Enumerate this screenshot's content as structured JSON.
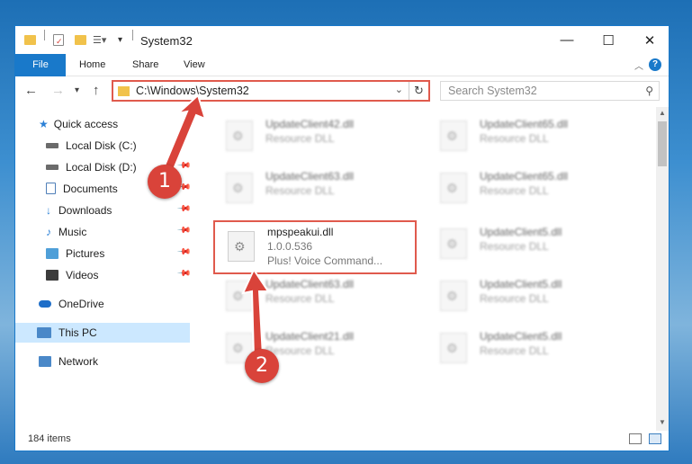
{
  "window": {
    "title": "System32"
  },
  "titlebar": {
    "minimize": "—",
    "maximize": "☐",
    "close": "✕"
  },
  "ribbon": {
    "tabs": [
      "File",
      "Home",
      "Share",
      "View"
    ],
    "help": "?"
  },
  "nav": {
    "address": "C:\\Windows\\System32",
    "search_placeholder": "Search System32"
  },
  "sidebar": {
    "items": [
      {
        "label": "Quick access",
        "icon": "star-icon",
        "color": "#2b80d6"
      },
      {
        "label": "Local Disk (C:)",
        "icon": "drive-icon",
        "color": "#6b6b6b"
      },
      {
        "label": "Local Disk (D:)",
        "icon": "drive-icon",
        "color": "#6b6b6b"
      },
      {
        "label": "Documents",
        "icon": "documents-icon",
        "color": "#4f7fb8"
      },
      {
        "label": "Downloads",
        "icon": "downloads-icon",
        "color": "#2b80d6"
      },
      {
        "label": "Music",
        "icon": "music-icon",
        "color": "#2b80d6"
      },
      {
        "label": "Pictures",
        "icon": "pictures-icon",
        "color": "#4f9fd8"
      },
      {
        "label": "Videos",
        "icon": "videos-icon",
        "color": "#3c3c3c"
      },
      {
        "label": "OneDrive",
        "icon": "cloud-icon",
        "color": "#1e6ec8"
      },
      {
        "label": "This PC",
        "icon": "computer-icon",
        "color": "#4a88c8"
      },
      {
        "label": "Network",
        "icon": "network-icon",
        "color": "#4a88c8"
      }
    ]
  },
  "files": [
    {
      "name": "UpdateClient42.dll",
      "type": "Resource DLL"
    },
    {
      "name": "UpdateClient65.dll",
      "type": "Resource DLL"
    },
    {
      "name": "UpdateClient63.dll",
      "type": "Resource DLL"
    },
    {
      "name": "UpdateClient65.dll",
      "type": "Resource DLL"
    },
    {
      "name": "mpspeakui.dll",
      "version": "1.0.0.536",
      "type": "Plus! Voice Command..."
    },
    {
      "name": "UpdateClient5.dll",
      "type": "Resource DLL"
    },
    {
      "name": "UpdateClient63.dll",
      "type": "Resource DLL"
    },
    {
      "name": "UpdateClient5.dll",
      "type": "Resource DLL"
    },
    {
      "name": "UpdateClient21.dll",
      "type": "Resource DLL"
    },
    {
      "name": "UpdateClient5.dll",
      "type": "Resource DLL"
    }
  ],
  "status": {
    "count": "184 items"
  },
  "annotations": {
    "step1": "1",
    "step2": "2",
    "color": "#d9433a"
  }
}
